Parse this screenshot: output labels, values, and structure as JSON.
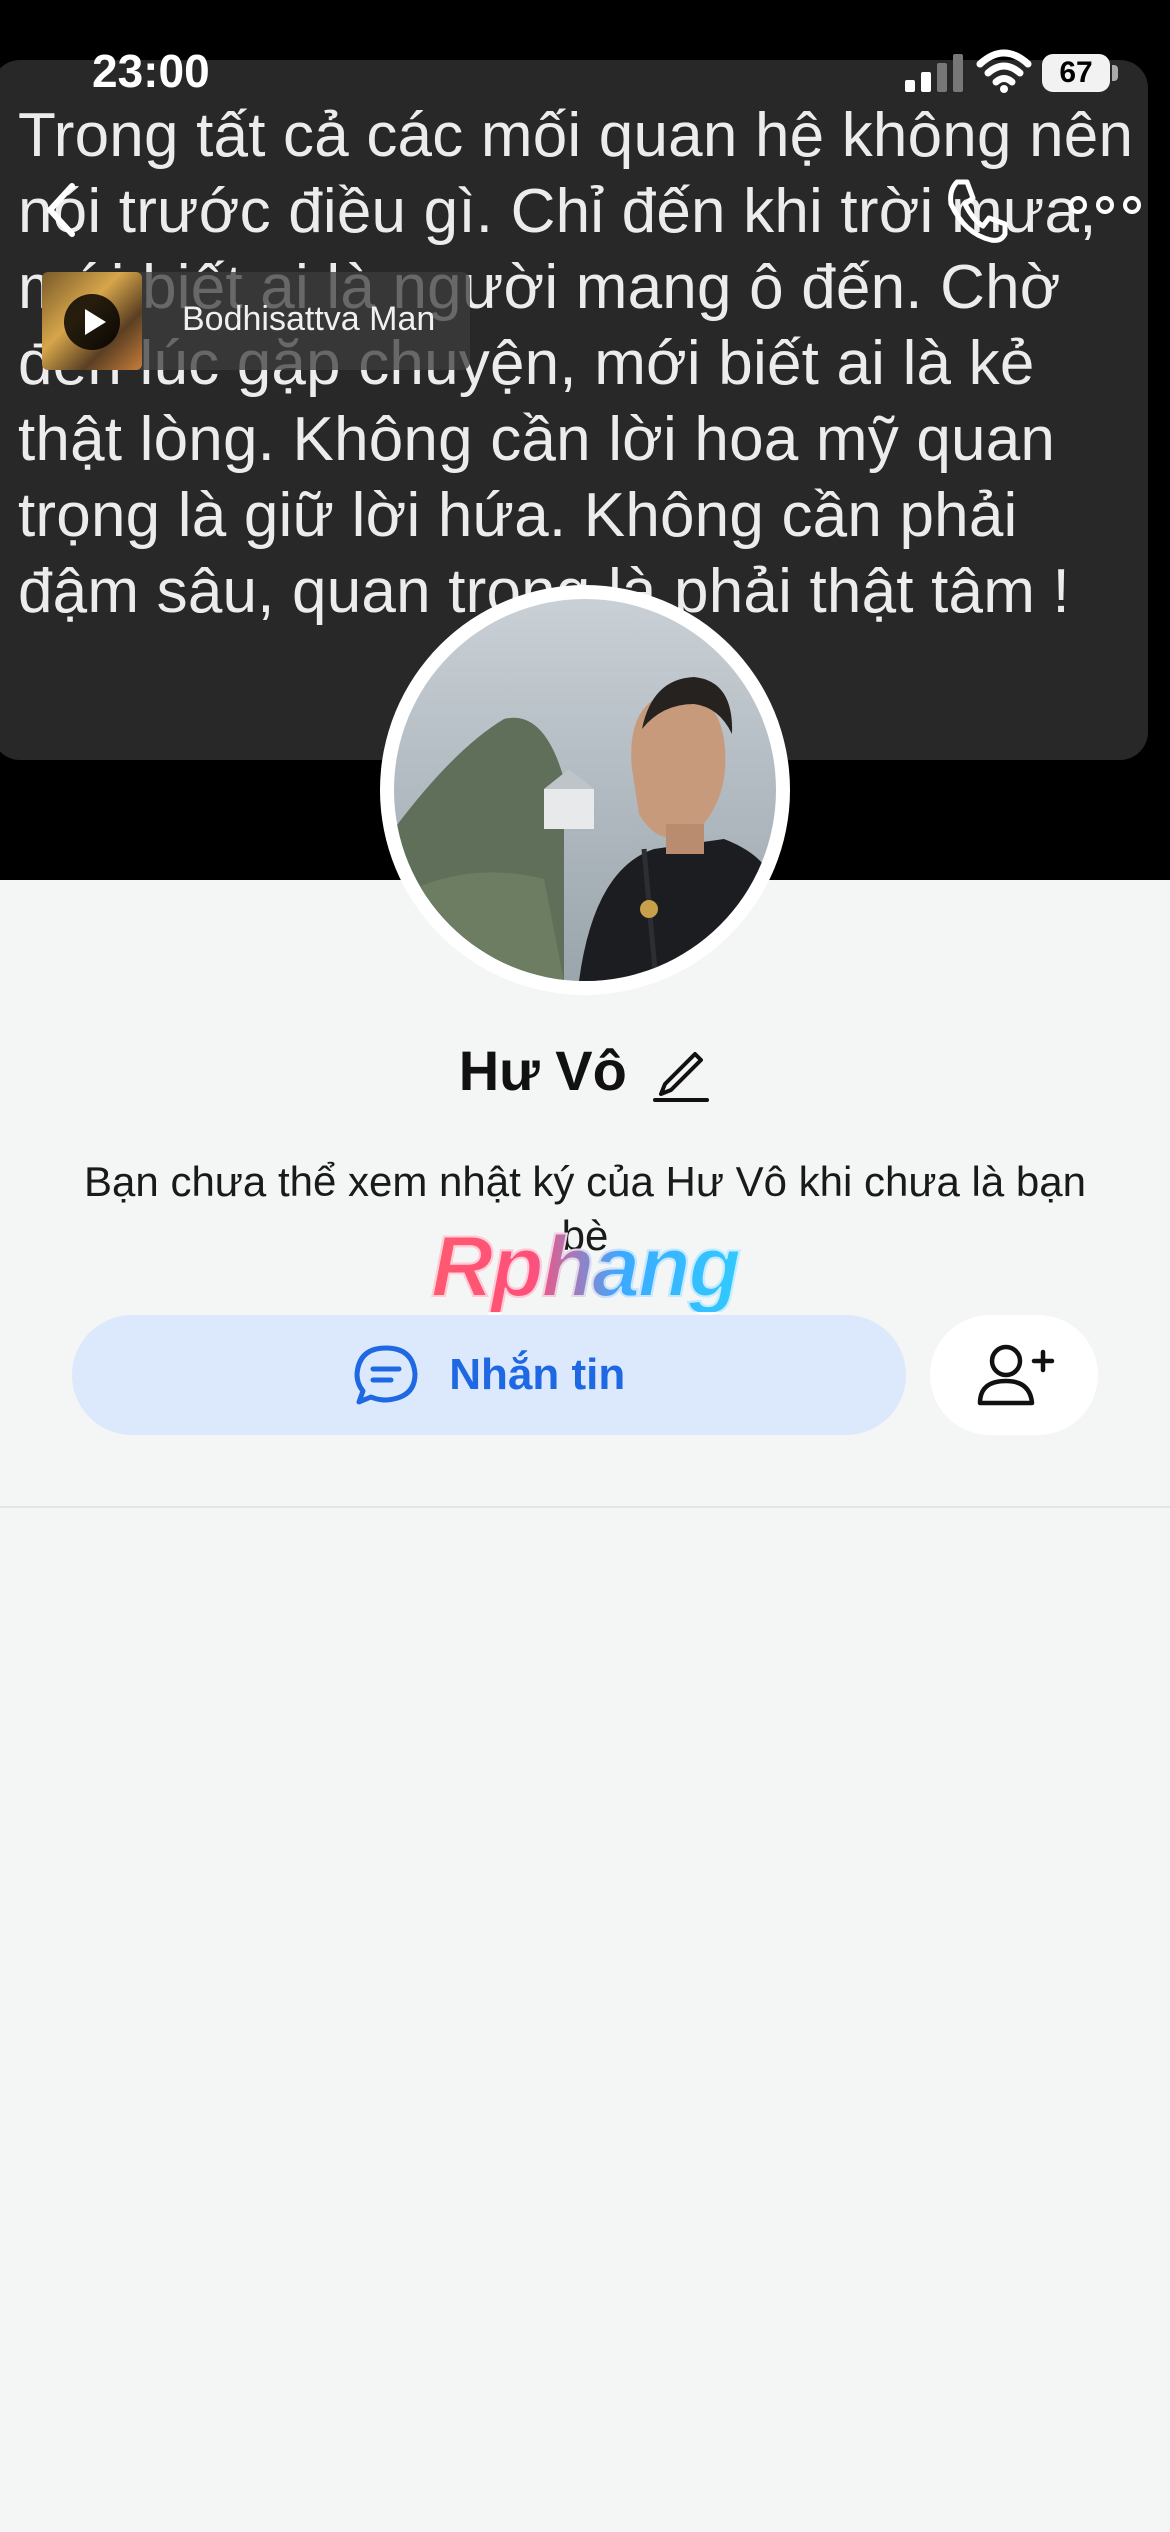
{
  "status_bar": {
    "time": "23:00",
    "battery": "67"
  },
  "cover": {
    "quote": "Trong tất cả các mối quan hệ không nên nói trước điều gì. Chỉ đến khi trời mưa, mới biết ai là người mang ô đến. Chờ đến lúc gặp chuyện, mới biết ai là kẻ thật lòng. Không cần lời hoa mỹ quan trọng là giữ lời hứa. Không cần phải đậm sâu, quan trọng là phải thật tâm !",
    "music_title": "Bodhisattva Man"
  },
  "profile": {
    "name": "Hư Vô",
    "notice": "Bạn chưa thể xem nhật ký của Hư Vô khi chưa là bạn bè",
    "watermark": "Rphang"
  },
  "actions": {
    "message_label": "Nhắn tin"
  },
  "icons": {
    "back": "back-arrow-icon",
    "call": "phone-icon",
    "more": "more-options-icon",
    "play": "play-icon",
    "edit": "pencil-icon",
    "chat": "chat-bubble-icon",
    "add_friend": "add-friend-icon"
  },
  "colors": {
    "accent": "#1f68e3",
    "message_bg": "#dce9fd",
    "page_bg": "#f4f5f5"
  }
}
